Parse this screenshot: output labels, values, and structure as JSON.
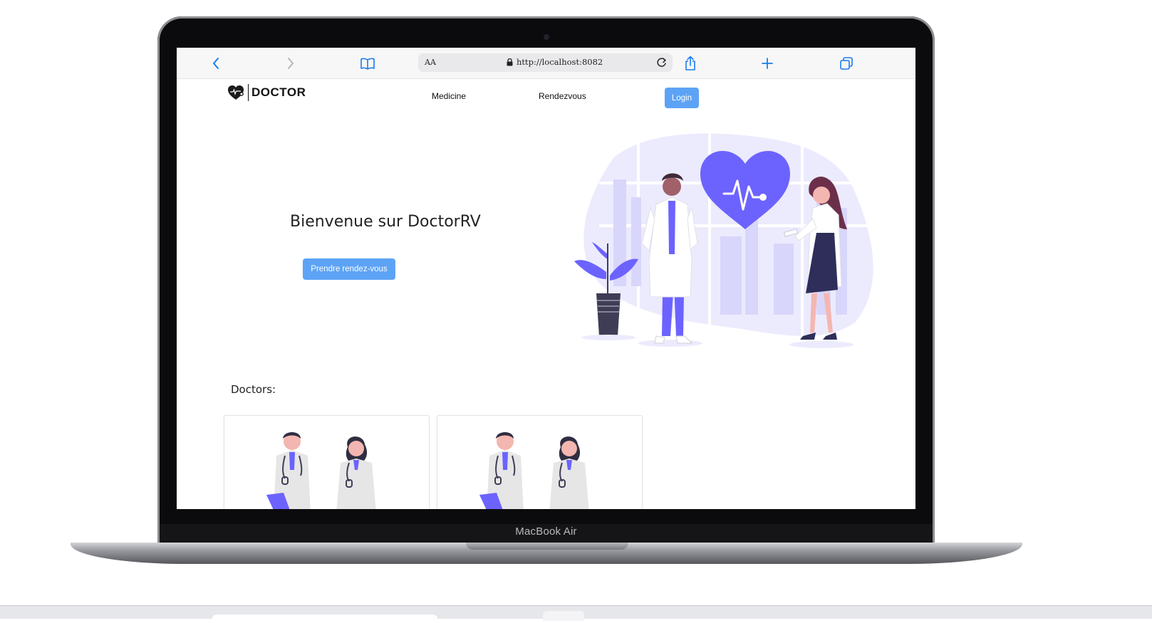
{
  "device": {
    "model_label": "MacBook Air"
  },
  "browser": {
    "address_aa": "AA",
    "url": "http://localhost:8082",
    "icons": [
      "back-icon",
      "forward-icon",
      "bookmarks-icon",
      "lock-icon",
      "reload-icon",
      "share-icon",
      "new-tab-icon",
      "tabs-icon"
    ]
  },
  "site": {
    "brand": "DOCTOR",
    "nav": {
      "medicine": "Medicine",
      "rendezvous": "Rendezvous",
      "login": "Login"
    },
    "hero": {
      "title": "Bienvenue sur DoctorRV",
      "cta": "Prendre rendez-vous"
    },
    "doctors": {
      "title": "Doctors:",
      "cards": 2
    }
  },
  "colors": {
    "accent": "#5da3f5",
    "illustration": "#6c63ff",
    "illustration_light": "#e8e6fd"
  }
}
